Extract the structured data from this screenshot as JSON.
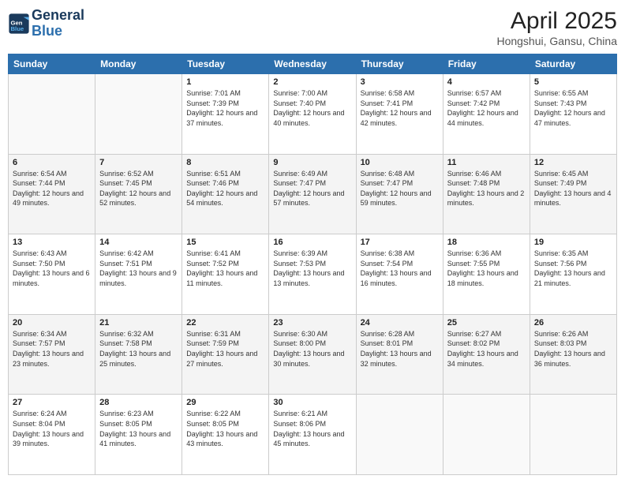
{
  "header": {
    "logo_line1": "General",
    "logo_line2": "Blue",
    "title": "April 2025",
    "subtitle": "Hongshui, Gansu, China"
  },
  "weekdays": [
    "Sunday",
    "Monday",
    "Tuesday",
    "Wednesday",
    "Thursday",
    "Friday",
    "Saturday"
  ],
  "weeks": [
    [
      {
        "day": "",
        "info": ""
      },
      {
        "day": "",
        "info": ""
      },
      {
        "day": "1",
        "info": "Sunrise: 7:01 AM\nSunset: 7:39 PM\nDaylight: 12 hours and 37 minutes."
      },
      {
        "day": "2",
        "info": "Sunrise: 7:00 AM\nSunset: 7:40 PM\nDaylight: 12 hours and 40 minutes."
      },
      {
        "day": "3",
        "info": "Sunrise: 6:58 AM\nSunset: 7:41 PM\nDaylight: 12 hours and 42 minutes."
      },
      {
        "day": "4",
        "info": "Sunrise: 6:57 AM\nSunset: 7:42 PM\nDaylight: 12 hours and 44 minutes."
      },
      {
        "day": "5",
        "info": "Sunrise: 6:55 AM\nSunset: 7:43 PM\nDaylight: 12 hours and 47 minutes."
      }
    ],
    [
      {
        "day": "6",
        "info": "Sunrise: 6:54 AM\nSunset: 7:44 PM\nDaylight: 12 hours and 49 minutes."
      },
      {
        "day": "7",
        "info": "Sunrise: 6:52 AM\nSunset: 7:45 PM\nDaylight: 12 hours and 52 minutes."
      },
      {
        "day": "8",
        "info": "Sunrise: 6:51 AM\nSunset: 7:46 PM\nDaylight: 12 hours and 54 minutes."
      },
      {
        "day": "9",
        "info": "Sunrise: 6:49 AM\nSunset: 7:47 PM\nDaylight: 12 hours and 57 minutes."
      },
      {
        "day": "10",
        "info": "Sunrise: 6:48 AM\nSunset: 7:47 PM\nDaylight: 12 hours and 59 minutes."
      },
      {
        "day": "11",
        "info": "Sunrise: 6:46 AM\nSunset: 7:48 PM\nDaylight: 13 hours and 2 minutes."
      },
      {
        "day": "12",
        "info": "Sunrise: 6:45 AM\nSunset: 7:49 PM\nDaylight: 13 hours and 4 minutes."
      }
    ],
    [
      {
        "day": "13",
        "info": "Sunrise: 6:43 AM\nSunset: 7:50 PM\nDaylight: 13 hours and 6 minutes."
      },
      {
        "day": "14",
        "info": "Sunrise: 6:42 AM\nSunset: 7:51 PM\nDaylight: 13 hours and 9 minutes."
      },
      {
        "day": "15",
        "info": "Sunrise: 6:41 AM\nSunset: 7:52 PM\nDaylight: 13 hours and 11 minutes."
      },
      {
        "day": "16",
        "info": "Sunrise: 6:39 AM\nSunset: 7:53 PM\nDaylight: 13 hours and 13 minutes."
      },
      {
        "day": "17",
        "info": "Sunrise: 6:38 AM\nSunset: 7:54 PM\nDaylight: 13 hours and 16 minutes."
      },
      {
        "day": "18",
        "info": "Sunrise: 6:36 AM\nSunset: 7:55 PM\nDaylight: 13 hours and 18 minutes."
      },
      {
        "day": "19",
        "info": "Sunrise: 6:35 AM\nSunset: 7:56 PM\nDaylight: 13 hours and 21 minutes."
      }
    ],
    [
      {
        "day": "20",
        "info": "Sunrise: 6:34 AM\nSunset: 7:57 PM\nDaylight: 13 hours and 23 minutes."
      },
      {
        "day": "21",
        "info": "Sunrise: 6:32 AM\nSunset: 7:58 PM\nDaylight: 13 hours and 25 minutes."
      },
      {
        "day": "22",
        "info": "Sunrise: 6:31 AM\nSunset: 7:59 PM\nDaylight: 13 hours and 27 minutes."
      },
      {
        "day": "23",
        "info": "Sunrise: 6:30 AM\nSunset: 8:00 PM\nDaylight: 13 hours and 30 minutes."
      },
      {
        "day": "24",
        "info": "Sunrise: 6:28 AM\nSunset: 8:01 PM\nDaylight: 13 hours and 32 minutes."
      },
      {
        "day": "25",
        "info": "Sunrise: 6:27 AM\nSunset: 8:02 PM\nDaylight: 13 hours and 34 minutes."
      },
      {
        "day": "26",
        "info": "Sunrise: 6:26 AM\nSunset: 8:03 PM\nDaylight: 13 hours and 36 minutes."
      }
    ],
    [
      {
        "day": "27",
        "info": "Sunrise: 6:24 AM\nSunset: 8:04 PM\nDaylight: 13 hours and 39 minutes."
      },
      {
        "day": "28",
        "info": "Sunrise: 6:23 AM\nSunset: 8:05 PM\nDaylight: 13 hours and 41 minutes."
      },
      {
        "day": "29",
        "info": "Sunrise: 6:22 AM\nSunset: 8:05 PM\nDaylight: 13 hours and 43 minutes."
      },
      {
        "day": "30",
        "info": "Sunrise: 6:21 AM\nSunset: 8:06 PM\nDaylight: 13 hours and 45 minutes."
      },
      {
        "day": "",
        "info": ""
      },
      {
        "day": "",
        "info": ""
      },
      {
        "day": "",
        "info": ""
      }
    ]
  ]
}
